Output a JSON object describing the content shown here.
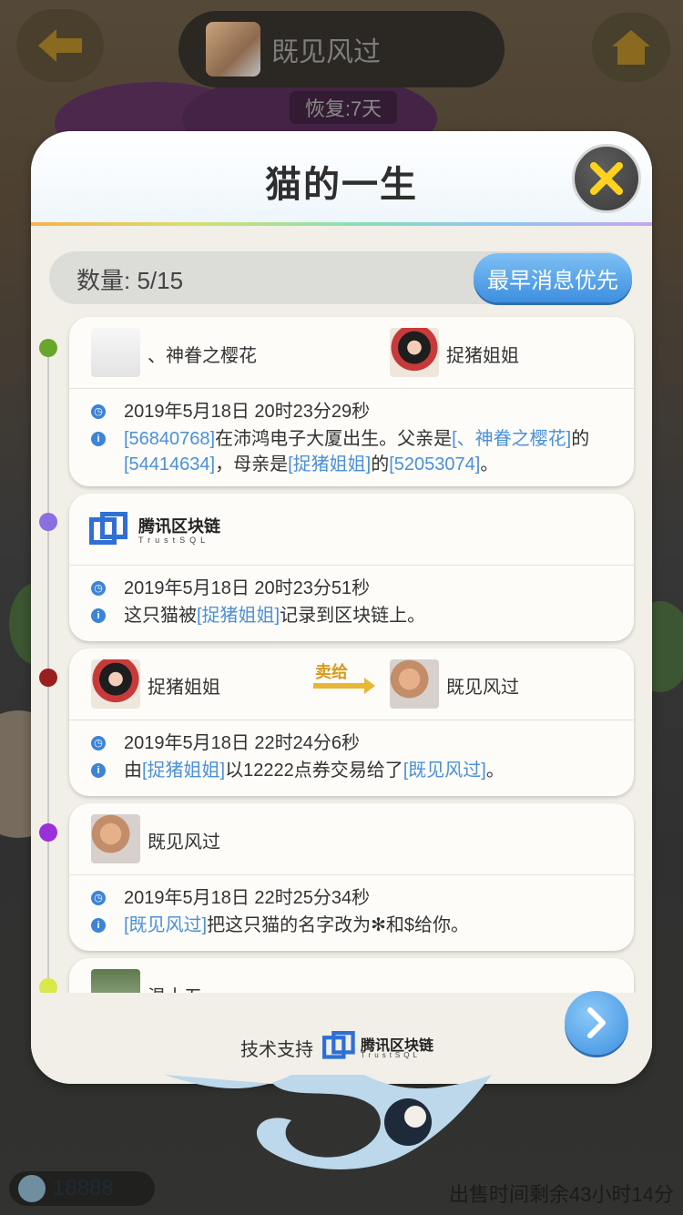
{
  "top_bar": {
    "owner_name": "既见风过",
    "recover_text": "恢复:7天"
  },
  "modal": {
    "title": "猫的一生",
    "count_label": "数量: 5/15",
    "sort_button": "最早消息优先",
    "footer_support": "技术支持",
    "logo_name": "腾讯区块链",
    "logo_sub": "TrustSQL"
  },
  "events": [
    {
      "dot_color": "#6aa52c",
      "father_name": "、神眷之樱花",
      "mother_name": "捉猪姐姐",
      "time": "2019年5月18日 20时23分29秒",
      "detail": [
        {
          "t": "[56840768]",
          "link": true
        },
        {
          "t": "在沛鸿电子大厦出生。父亲是",
          "link": false
        },
        {
          "t": "[、神眷之樱花]",
          "link": true
        },
        {
          "t": "的",
          "link": false
        },
        {
          "t": "[54414634]",
          "link": true
        },
        {
          "t": "，母亲是",
          "link": false
        },
        {
          "t": "[捉猪姐姐]",
          "link": true
        },
        {
          "t": "的",
          "link": false
        },
        {
          "t": "[52053074]",
          "link": true
        },
        {
          "t": "。",
          "link": false
        }
      ]
    },
    {
      "dot_color": "#8a6fe0",
      "logo_name": "腾讯区块链",
      "logo_sub": "TrustSQL",
      "time": "2019年5月18日 20时23分51秒",
      "detail": [
        {
          "t": "这只猫被",
          "link": false
        },
        {
          "t": "[捉猪姐姐]",
          "link": true
        },
        {
          "t": "记录到区块链上。",
          "link": false
        }
      ]
    },
    {
      "dot_color": "#9a1e1e",
      "seller_name": "捉猪姐姐",
      "sell_label": "卖给",
      "buyer_name": "既见风过",
      "time": "2019年5月18日 22时24分6秒",
      "detail": [
        {
          "t": "由",
          "link": false
        },
        {
          "t": "[捉猪姐姐]",
          "link": true
        },
        {
          "t": "以12222点券交易给了",
          "link": false
        },
        {
          "t": "[既见风过]",
          "link": true
        },
        {
          "t": "。",
          "link": false
        }
      ]
    },
    {
      "dot_color": "#9b2fd8",
      "user_name": "既见风过",
      "time": "2019年5月18日 22时25分34秒",
      "detail": [
        {
          "t": "[既见风过]",
          "link": true
        },
        {
          "t": "把这只猫的名字改为✻和$给你。",
          "link": false
        }
      ]
    },
    {
      "dot_color": "#d9e84a",
      "user_name": "温十五"
    }
  ],
  "bottom": {
    "coins": "18888",
    "sell_time": "出售时间剩余43小时14分"
  },
  "icons": {
    "back": "arrow-left-icon",
    "home": "home-icon",
    "close": "close-icon",
    "next": "chevron-right-icon",
    "clock": "clock-icon",
    "info": "info-icon"
  },
  "colors": {
    "link": "#4a90d9",
    "accent_blue": "#3d8fe0",
    "close_x": "#ffd21f"
  }
}
